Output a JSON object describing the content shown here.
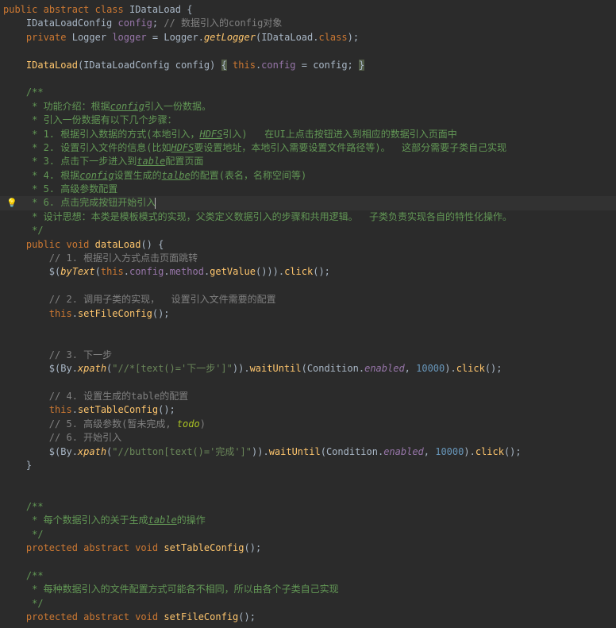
{
  "code": {
    "l1_kw1": "public",
    "l1_kw2": "abstract",
    "l1_kw3": "class",
    "l1_cls": "IDataLoad",
    "l1_brace": " {",
    "l2_type": "IDataLoadConfig",
    "l2_field": "config",
    "l2_semi": "; ",
    "l2_comment": "// 数据引入的config对象",
    "l3_kw": "private",
    "l3_type": "Logger",
    "l3_field": "logger",
    "l3_eq": " = ",
    "l3_cls": "Logger",
    "l3_dot": ".",
    "l3_method": "getLogger",
    "l3_open": "(",
    "l3_arg": "IDataLoad",
    "l3_dot2": ".",
    "l3_kwclass": "class",
    "l3_close": ");",
    "l5_type": "IDataLoad",
    "l5_open": "(IDataLoadConfig config) ",
    "l5_fold_open": "{",
    "l5_body1": " ",
    "l5_kw": "this",
    "l5_dot": ".",
    "l5_field": "config",
    "l5_eq": " = config; ",
    "l5_fold_close": "}",
    "d1": "/**",
    "d2": " * 功能介绍：根据",
    "d2i": "config",
    "d2b": "引入一份数据。",
    "d3": " * 引入一份数据有以下几个步骤：",
    "d4": " * 1. 根据引入数据的方式(本地引入，",
    "d4i": "HDFS",
    "d4b": "引入)   在UI上点击按钮进入到相应的数据引入页面中",
    "d5": " * 2. 设置引入文件的信息(比如",
    "d5i": "HDFS",
    "d5b": "要设置地址，本地引入需要设置文件路径等)。  这部分需要子类自己实现",
    "d6": " * 3. 点击下一步进入到",
    "d6i": "table",
    "d6b": "配置页面",
    "d7": " * 4. 根据",
    "d7i": "config",
    "d7b": "设置生成的",
    "d7i2": "talbe",
    "d7c": "的配置(表名，名称空间等)",
    "d8": " * 5. 高级参数配置",
    "d9": " * 6. 点击完成按钮开始引入",
    "d10": " * 设计思想：本类是模板模式的实现，父类定义数据引入的步骤和共用逻辑。  子类负责实现各自的特性化操作。",
    "d11": " */",
    "m1_kw1": "public",
    "m1_kw2": "void",
    "m1_name": "dataLoad",
    "m1_sig": "() {",
    "c1": "// 1. 根据引入方式点击页面跳转",
    "s1_a": "$(",
    "s1_m1": "byText",
    "s1_b": "(",
    "s1_kw": "this",
    "s1_c": ".",
    "s1_f": "config",
    "s1_d": ".",
    "s1_f2": "method",
    "s1_e": ".",
    "s1_m2": "getValue",
    "s1_g": "())).",
    "s1_m3": "click",
    "s1_h": "();",
    "c2": "// 2. 调用子类的实现，  设置引入文件需要的配置",
    "s2_kw": "this",
    "s2_a": ".",
    "s2_m": "setFileConfig",
    "s2_b": "();",
    "c3": "// 3. 下一步",
    "s3_a": "$(By.",
    "s3_m1": "xpath",
    "s3_b": "(",
    "s3_str": "\"//*[text()='下一步']\"",
    "s3_c": ")).",
    "s3_m2": "waitUntil",
    "s3_d": "(Condition.",
    "s3_f": "enabled",
    "s3_e": ", ",
    "s3_n": "10000",
    "s3_g": ").",
    "s3_m3": "click",
    "s3_h": "();",
    "c4": "// 4. 设置生成的table的配置",
    "s4_kw": "this",
    "s4_a": ".",
    "s4_m": "setTableConfig",
    "s4_b": "();",
    "c5a": "// 5. 高级参数(暂未完成, ",
    "c5todo": "todo",
    "c5b": ")",
    "c6": "// 6. 开始引入",
    "s6_a": "$(By.",
    "s6_m1": "xpath",
    "s6_b": "(",
    "s6_str": "\"//button[text()='完成']\"",
    "s6_c": ")).",
    "s6_m2": "waitUntil",
    "s6_d": "(Condition.",
    "s6_f": "enabled",
    "s6_e": ", ",
    "s6_n": "10000",
    "s6_g": ").",
    "s6_m3": "click",
    "s6_h": "();",
    "m1_end": "}",
    "dA1": "/**",
    "dA2": " * 每个数据引入的关于生成",
    "dA2i": "table",
    "dA2b": "的操作",
    "dA3": " */",
    "a1_kw1": "protected",
    "a1_kw2": "abstract",
    "a1_kw3": "void",
    "a1_name": "setTableConfig",
    "a1_end": "();",
    "dB1": "/**",
    "dB2": " * 每种数据引入的文件配置方式可能各不相同，所以由各个子类自己实现",
    "dB3": " */",
    "b1_kw1": "protected",
    "b1_kw2": "abstract",
    "b1_kw3": "void",
    "b1_name": "setFileConfig",
    "b1_end": "();"
  }
}
